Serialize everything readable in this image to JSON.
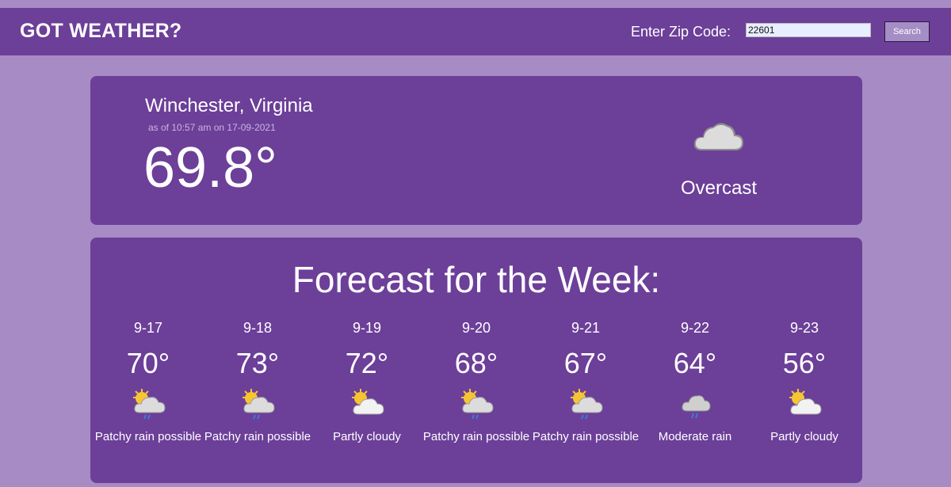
{
  "header": {
    "brand": "GOT WEATHER?",
    "zip_label": "Enter Zip Code:",
    "zip_value": "22601",
    "search_label": "Search"
  },
  "current": {
    "location": "Winchester, Virginia",
    "as_of": "as of 10:57 am on 17-09-2021",
    "temperature": "69.8°",
    "condition": "Overcast",
    "icon": "cloud-icon"
  },
  "forecast": {
    "title": "Forecast for the Week:",
    "days": [
      {
        "date": "9-17",
        "temp": "70°",
        "condition": "Patchy rain possible",
        "icon": "patchy-rain-icon"
      },
      {
        "date": "9-18",
        "temp": "73°",
        "condition": "Patchy rain possible",
        "icon": "patchy-rain-icon"
      },
      {
        "date": "9-19",
        "temp": "72°",
        "condition": "Partly cloudy",
        "icon": "partly-cloudy-icon"
      },
      {
        "date": "9-20",
        "temp": "68°",
        "condition": "Patchy rain possible",
        "icon": "patchy-rain-icon"
      },
      {
        "date": "9-21",
        "temp": "67°",
        "condition": "Patchy rain possible",
        "icon": "patchy-rain-icon"
      },
      {
        "date": "9-22",
        "temp": "64°",
        "condition": "Moderate rain",
        "icon": "moderate-rain-icon"
      },
      {
        "date": "9-23",
        "temp": "56°",
        "condition": "Partly cloudy",
        "icon": "partly-cloudy-icon"
      }
    ]
  },
  "colors": {
    "page_bg": "#a78bc4",
    "panel": "#6c3f99",
    "text": "#ffffff",
    "sun": "#f7c532",
    "rain": "#3f7bd6"
  }
}
